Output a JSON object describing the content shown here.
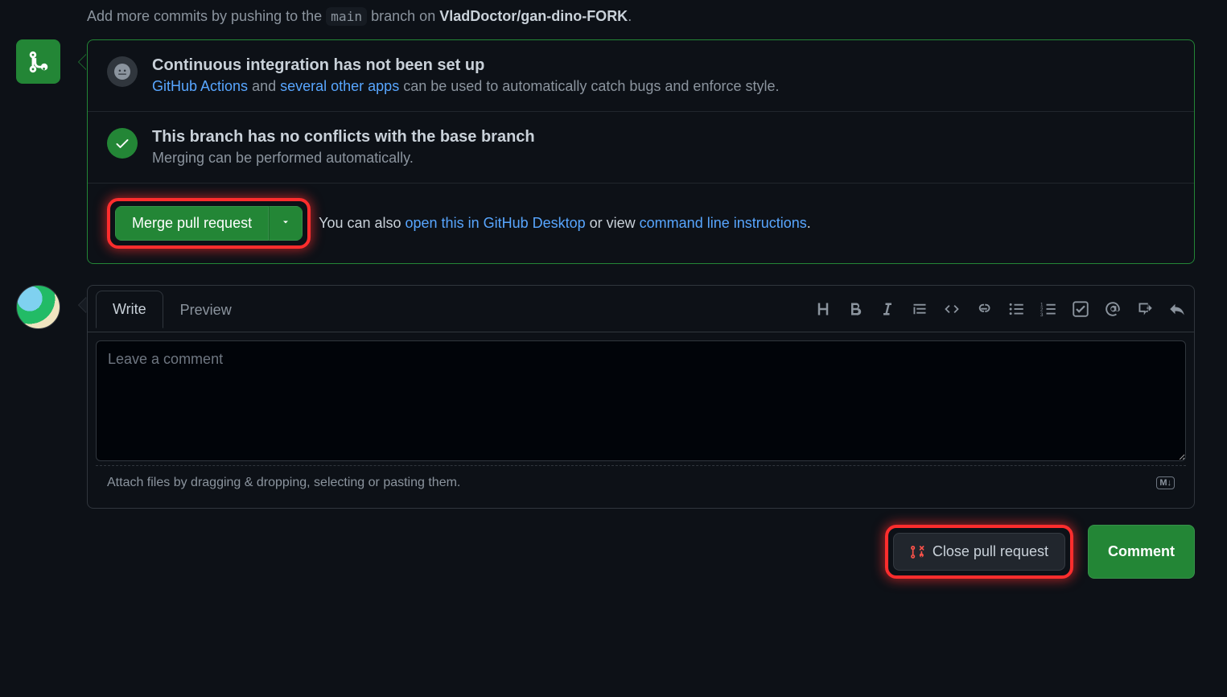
{
  "push_hint": {
    "prefix": "Add more commits by pushing to the ",
    "branch": "main",
    "middle": " branch on ",
    "repo": "VladDoctor/gan-dino-FORK",
    "suffix": "."
  },
  "merge_box": {
    "ci": {
      "title": "Continuous integration has not been set up",
      "link1": "GitHub Actions",
      "text_and": " and ",
      "link2": "several other apps",
      "text_tail": " can be used to automatically catch bugs and enforce style."
    },
    "conflict": {
      "title": "This branch has no conflicts with the base branch",
      "subtitle": "Merging can be performed automatically."
    },
    "actions": {
      "merge_label": "Merge pull request",
      "also_prefix": "You can also ",
      "open_desktop": "open this in GitHub Desktop",
      "or_view": " or view ",
      "cli": "command line instructions",
      "tail": "."
    }
  },
  "comment": {
    "tabs": {
      "write": "Write",
      "preview": "Preview"
    },
    "placeholder": "Leave a comment",
    "value": "",
    "attach_hint": "Attach files by dragging & dropping, selecting or pasting them.",
    "md_badge": "M↓"
  },
  "footer": {
    "close_label": "Close pull request",
    "comment_label": "Comment"
  }
}
